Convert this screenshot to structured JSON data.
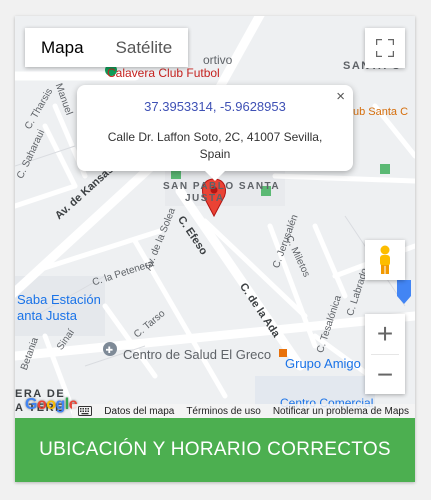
{
  "map": {
    "type_buttons": {
      "map": "Mapa",
      "satellite": "Satélite"
    },
    "info_window": {
      "coords": "37.3953314, -5.9628953",
      "address": "Calle Dr. Laffon Soto, 2C, 41007 Sevilla, Spain",
      "close": "×"
    },
    "labels": {
      "calavera": "Calavera Club Futbol",
      "ortivo": "ortivo",
      "club_santa": "ub Santa C",
      "santa": "SANTA C",
      "san_pablo": "SAN PABLO SANTA",
      "san_pablo_2": "JUSTA",
      "kansas": "Av. de Kansas City",
      "solea": "Av. de la Solea",
      "efeso": "C. Efeso",
      "ada": "C. de la Ada",
      "jerusalen": "C. Jerusalén",
      "miletos": "C. Miletos",
      "petenera": "C. la Petenera",
      "tarso": "C. Tarso",
      "tesalonica": "C. Tesalónica",
      "labrado": "C. Labrado",
      "sinai": "Sinaí",
      "betania": "Betania",
      "estacion": "Saba Estación",
      "estacion_2": "anta Justa",
      "centro_salud": "Centro de Salud El Greco",
      "grupo_amigo": "Grupo Amigo S.",
      "comercial": "Centro Comercial",
      "manuel": "Manuel",
      "tharsis": "C. Tharsis",
      "sahara": "C. Saharaui",
      "era": "ERA DE",
      "tere": "A TERE"
    },
    "attribution": {
      "logo": "Google",
      "data": "Datos del mapa",
      "terms": "Términos de uso",
      "report": "Notificar un problema de Maps"
    }
  },
  "action_button": "UBICACIÓN Y HORARIO CORRECTOS",
  "colors": {
    "button": "#4caf50",
    "pin": "#ea4335",
    "coords_link": "#3f51b5"
  }
}
